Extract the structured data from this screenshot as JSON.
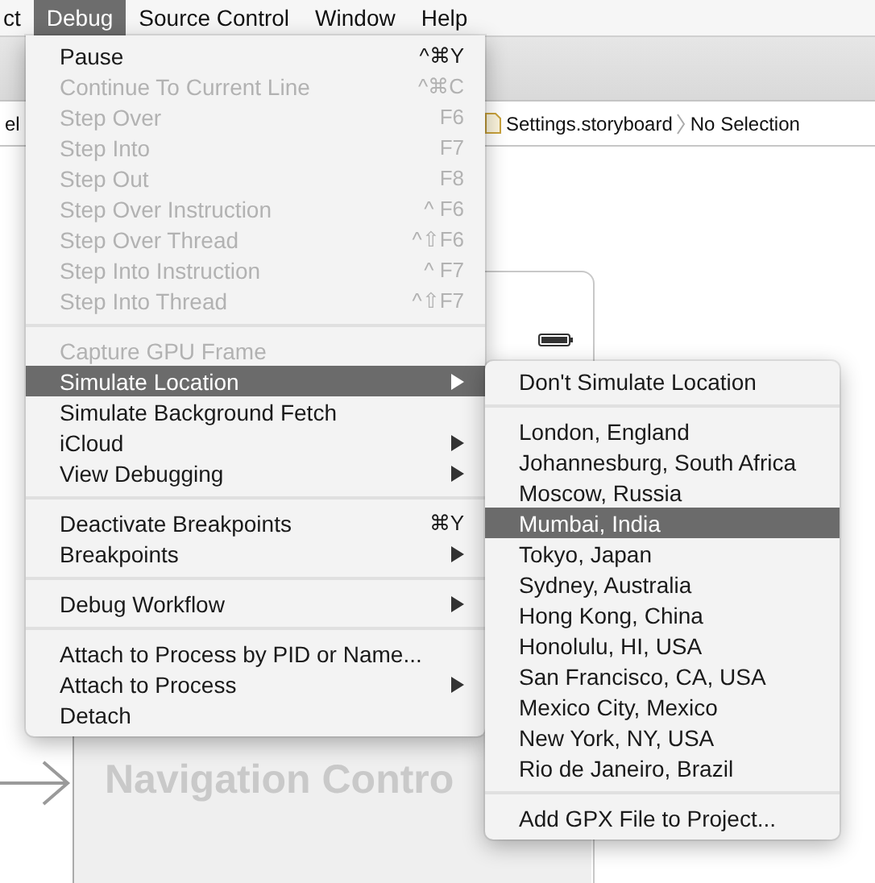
{
  "menu_bar": [
    {
      "label": "ct",
      "selected": false
    },
    {
      "label": "Debug",
      "selected": true
    },
    {
      "label": "Source Control",
      "selected": false
    },
    {
      "label": "Window",
      "selected": false
    },
    {
      "label": "Help",
      "selected": false
    }
  ],
  "jump_bar": {
    "left_fragment": "el",
    "file": "Settings.storyboard",
    "selection": "No Selection"
  },
  "canvas": {
    "scene_title": "Navigation Contro"
  },
  "debug_menu": [
    {
      "kind": "item",
      "label": "Pause",
      "shortcut": "^⌘Y",
      "disabled": false,
      "selected": false,
      "submenu": false
    },
    {
      "kind": "item",
      "label": "Continue To Current Line",
      "shortcut": "^⌘C",
      "disabled": true,
      "selected": false,
      "submenu": false
    },
    {
      "kind": "item",
      "label": "Step Over",
      "shortcut": "F6",
      "disabled": true,
      "selected": false,
      "submenu": false
    },
    {
      "kind": "item",
      "label": "Step Into",
      "shortcut": "F7",
      "disabled": true,
      "selected": false,
      "submenu": false
    },
    {
      "kind": "item",
      "label": "Step Out",
      "shortcut": "F8",
      "disabled": true,
      "selected": false,
      "submenu": false
    },
    {
      "kind": "item",
      "label": "Step Over Instruction",
      "shortcut": "^ F6",
      "disabled": true,
      "selected": false,
      "submenu": false
    },
    {
      "kind": "item",
      "label": "Step Over Thread",
      "shortcut": "^⇧F6",
      "disabled": true,
      "selected": false,
      "submenu": false
    },
    {
      "kind": "item",
      "label": "Step Into Instruction",
      "shortcut": "^ F7",
      "disabled": true,
      "selected": false,
      "submenu": false
    },
    {
      "kind": "item",
      "label": "Step Into Thread",
      "shortcut": "^⇧F7",
      "disabled": true,
      "selected": false,
      "submenu": false
    },
    {
      "kind": "separator"
    },
    {
      "kind": "item",
      "label": "Capture GPU Frame",
      "disabled": true,
      "selected": false,
      "submenu": false
    },
    {
      "kind": "item",
      "label": "Simulate Location",
      "disabled": false,
      "selected": true,
      "submenu": true
    },
    {
      "kind": "item",
      "label": "Simulate Background Fetch",
      "disabled": false,
      "selected": false,
      "submenu": false
    },
    {
      "kind": "item",
      "label": "iCloud",
      "disabled": false,
      "selected": false,
      "submenu": true
    },
    {
      "kind": "item",
      "label": "View Debugging",
      "disabled": false,
      "selected": false,
      "submenu": true
    },
    {
      "kind": "separator"
    },
    {
      "kind": "item",
      "label": "Deactivate Breakpoints",
      "shortcut": "⌘Y",
      "disabled": false,
      "selected": false,
      "submenu": false
    },
    {
      "kind": "item",
      "label": "Breakpoints",
      "disabled": false,
      "selected": false,
      "submenu": true
    },
    {
      "kind": "separator"
    },
    {
      "kind": "item",
      "label": "Debug Workflow",
      "disabled": false,
      "selected": false,
      "submenu": true
    },
    {
      "kind": "separator"
    },
    {
      "kind": "item",
      "label": "Attach to Process by PID or Name...",
      "disabled": false,
      "selected": false,
      "submenu": false
    },
    {
      "kind": "item",
      "label": "Attach to Process",
      "disabled": false,
      "selected": false,
      "submenu": true
    },
    {
      "kind": "item",
      "label": "Detach",
      "disabled": false,
      "selected": false,
      "submenu": false
    }
  ],
  "location_submenu": [
    {
      "kind": "item",
      "label": "Don't Simulate Location",
      "selected": false
    },
    {
      "kind": "separator"
    },
    {
      "kind": "item",
      "label": "London, England",
      "selected": false
    },
    {
      "kind": "item",
      "label": "Johannesburg, South Africa",
      "selected": false
    },
    {
      "kind": "item",
      "label": "Moscow, Russia",
      "selected": false
    },
    {
      "kind": "item",
      "label": "Mumbai, India",
      "selected": true
    },
    {
      "kind": "item",
      "label": "Tokyo, Japan",
      "selected": false
    },
    {
      "kind": "item",
      "label": "Sydney, Australia",
      "selected": false
    },
    {
      "kind": "item",
      "label": "Hong Kong, China",
      "selected": false
    },
    {
      "kind": "item",
      "label": "Honolulu, HI, USA",
      "selected": false
    },
    {
      "kind": "item",
      "label": "San Francisco, CA, USA",
      "selected": false
    },
    {
      "kind": "item",
      "label": "Mexico City, Mexico",
      "selected": false
    },
    {
      "kind": "item",
      "label": "New York, NY, USA",
      "selected": false
    },
    {
      "kind": "item",
      "label": "Rio de Janeiro, Brazil",
      "selected": false
    },
    {
      "kind": "separator"
    },
    {
      "kind": "item",
      "label": "Add GPX File to Project...",
      "selected": false
    }
  ]
}
